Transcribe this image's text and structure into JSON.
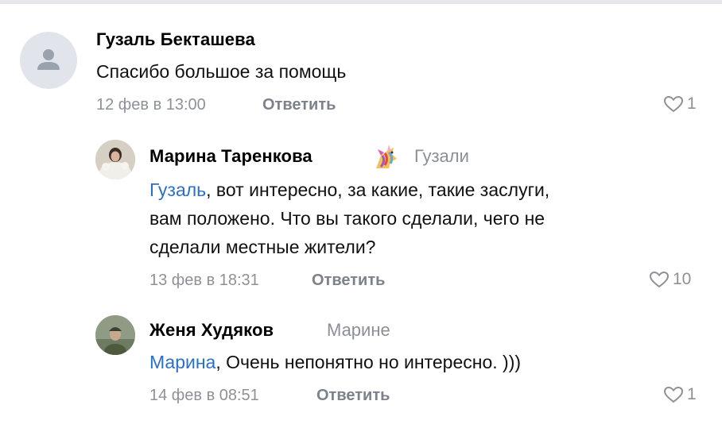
{
  "comments": [
    {
      "author": "Гузаль Бекташева",
      "text": "Спасибо большое за помощь",
      "date": "12 фев в 13:00",
      "reply_label": "Ответить",
      "likes": "1"
    },
    {
      "author": "Марина Таренкова",
      "reply_to": "Гузали",
      "mention": "Гузаль",
      "text_line1": ", вот интересно, за какие, такие заслуги,",
      "text_line2": "вам положено. Что вы такого сделали, чего не",
      "text_line3": "сделали местные жители?",
      "date": "13 фев в 18:31",
      "reply_label": "Ответить",
      "likes": "10"
    },
    {
      "author": "Женя Худяков",
      "reply_to": "Марине",
      "mention": "Марина",
      "text": ", Очень  непонятно но интересно. )))",
      "date": "14 фев в 08:51",
      "reply_label": "Ответить",
      "likes": "1"
    }
  ],
  "icons": {
    "default_avatar": "user-silhouette-icon",
    "like": "heart-outline-icon",
    "badge": "unicorn-icon"
  },
  "colors": {
    "mention": "#2a6fc9",
    "meta": "#8d9198"
  }
}
